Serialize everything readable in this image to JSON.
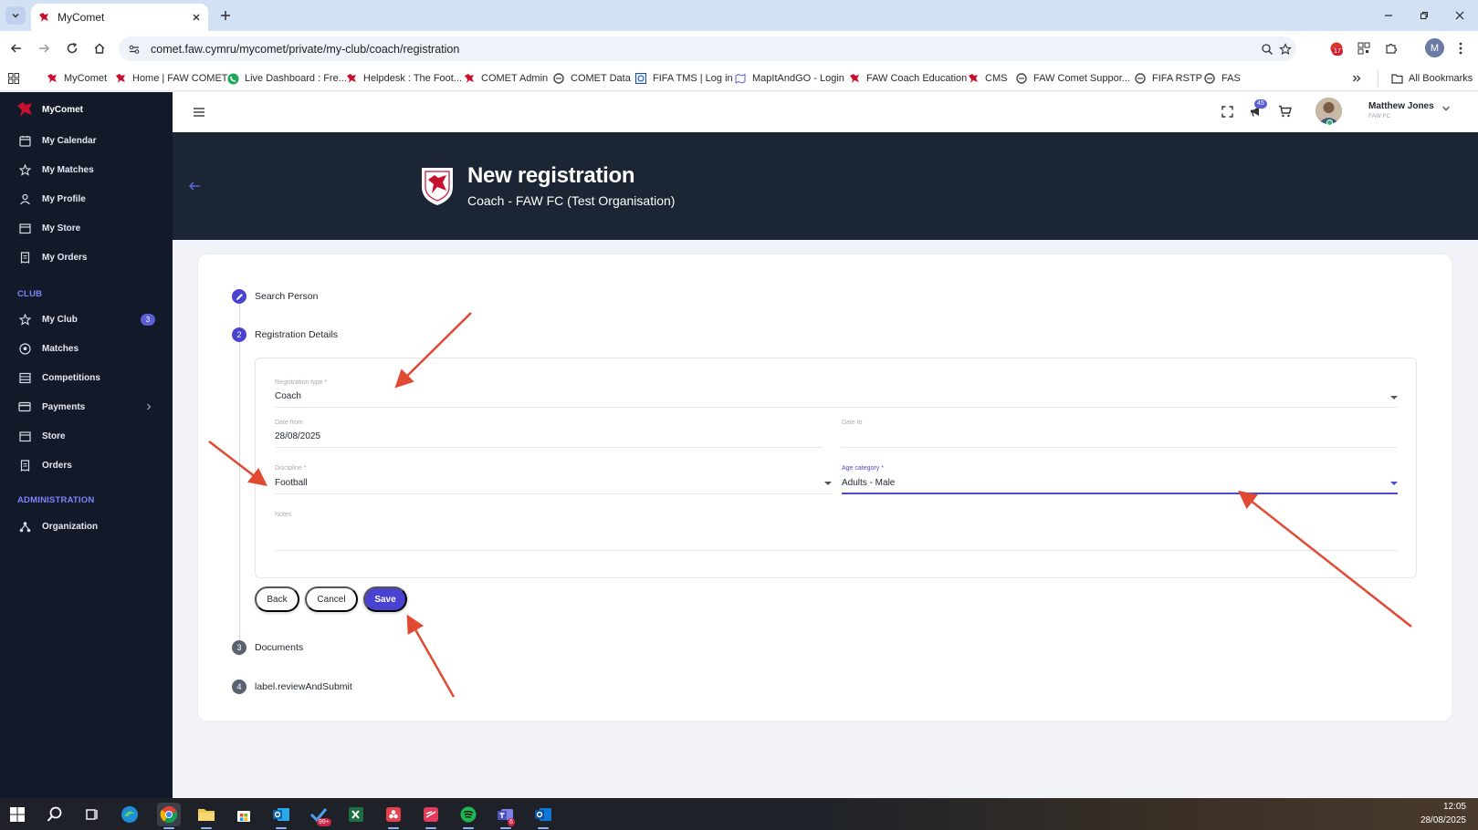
{
  "browser": {
    "tab_title": "MyComet",
    "url": "comet.faw.cymru/mycomet/private/my-club/coach/registration",
    "extension_badge": "17",
    "profile_initial": "M",
    "bookmarks": [
      "MyComet",
      "Home | FAW COMET",
      "Live Dashboard : Fre...",
      "Helpdesk : The Foot...",
      "COMET Admin",
      "COMET Data",
      "FIFA TMS | Log in",
      "MapItAndGO - Login",
      "FAW Coach Education",
      "CMS",
      "FAW Comet Suppor...",
      "FIFA RSTP",
      "FAS"
    ],
    "all_bookmarks_label": "All Bookmarks"
  },
  "sidebar": {
    "brand": "MyComet",
    "personal_items": [
      "My Calendar",
      "My Matches",
      "My Profile",
      "My Store",
      "My Orders"
    ],
    "club_section": "CLUB",
    "club_items": [
      "My Club",
      "Matches",
      "Competitions",
      "Payments",
      "Store",
      "Orders"
    ],
    "club_badge": "3",
    "admin_section": "ADMINISTRATION",
    "admin_items": [
      "Organization"
    ]
  },
  "appbar": {
    "notification_count": "45",
    "user_name": "Matthew Jones",
    "user_org": "FAW FC"
  },
  "header": {
    "title": "New registration",
    "subtitle": "Coach - FAW FC (Test Organisation)"
  },
  "steps": [
    {
      "num": "",
      "label": "Search Person"
    },
    {
      "num": "2",
      "label": "Registration Details"
    },
    {
      "num": "3",
      "label": "Documents"
    },
    {
      "num": "4",
      "label": "label.reviewAndSubmit"
    }
  ],
  "form": {
    "registration_type_label": "Registration type *",
    "registration_type_value": "Coach",
    "date_from_label": "Date from",
    "date_from_value": "28/08/2025",
    "date_to_label": "Date to",
    "date_to_value": "",
    "discipline_label": "Discipline *",
    "discipline_value": "Football",
    "age_category_label": "Age category *",
    "age_category_value": "Adults - Male",
    "notes_label": "Notes",
    "notes_value": ""
  },
  "buttons": {
    "back": "Back",
    "cancel": "Cancel",
    "save": "Save"
  },
  "taskbar": {
    "outlook_badge": "99+",
    "teams_badge": "6",
    "time": "12:05",
    "date": "28/08/2025"
  },
  "colors": {
    "accent": "#4a43d2",
    "sidebar_bg": "#121929",
    "banner_bg": "#1b2533",
    "annotation_arrow": "#e04a32"
  }
}
